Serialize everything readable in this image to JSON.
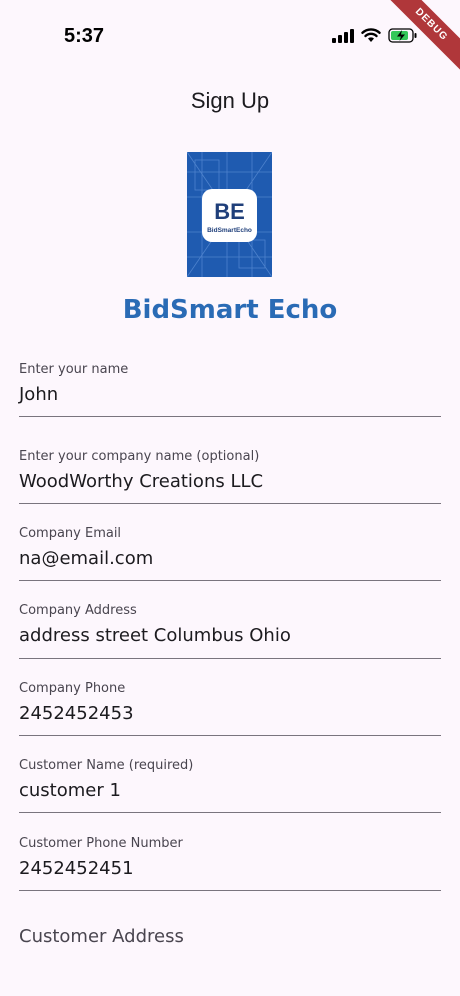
{
  "status_bar": {
    "time": "5:37",
    "icons": [
      "signal-icon",
      "wifi-icon",
      "battery-charging-icon"
    ],
    "debug_label": "DEBUG"
  },
  "header": {
    "title": "Sign Up"
  },
  "logo": {
    "text": "BidSmartEcho",
    "monogram": "BE"
  },
  "brand": {
    "name": "BidSmart Echo",
    "color": "#2a6bb5"
  },
  "form": {
    "fields": [
      {
        "label": "Enter your name",
        "value": "John"
      },
      {
        "label": "Enter your company name (optional)",
        "value": "WoodWorthy Creations LLC"
      },
      {
        "label": "Company Email",
        "value": "na@email.com"
      },
      {
        "label": "Company Address",
        "value": "address street Columbus Ohio"
      },
      {
        "label": "Company Phone",
        "value": "2452452453"
      },
      {
        "label": "Customer Name (required)",
        "value": "customer 1"
      },
      {
        "label": "Customer Phone Number",
        "value": "2452452451"
      }
    ],
    "customer_address_placeholder": "Customer Address"
  }
}
